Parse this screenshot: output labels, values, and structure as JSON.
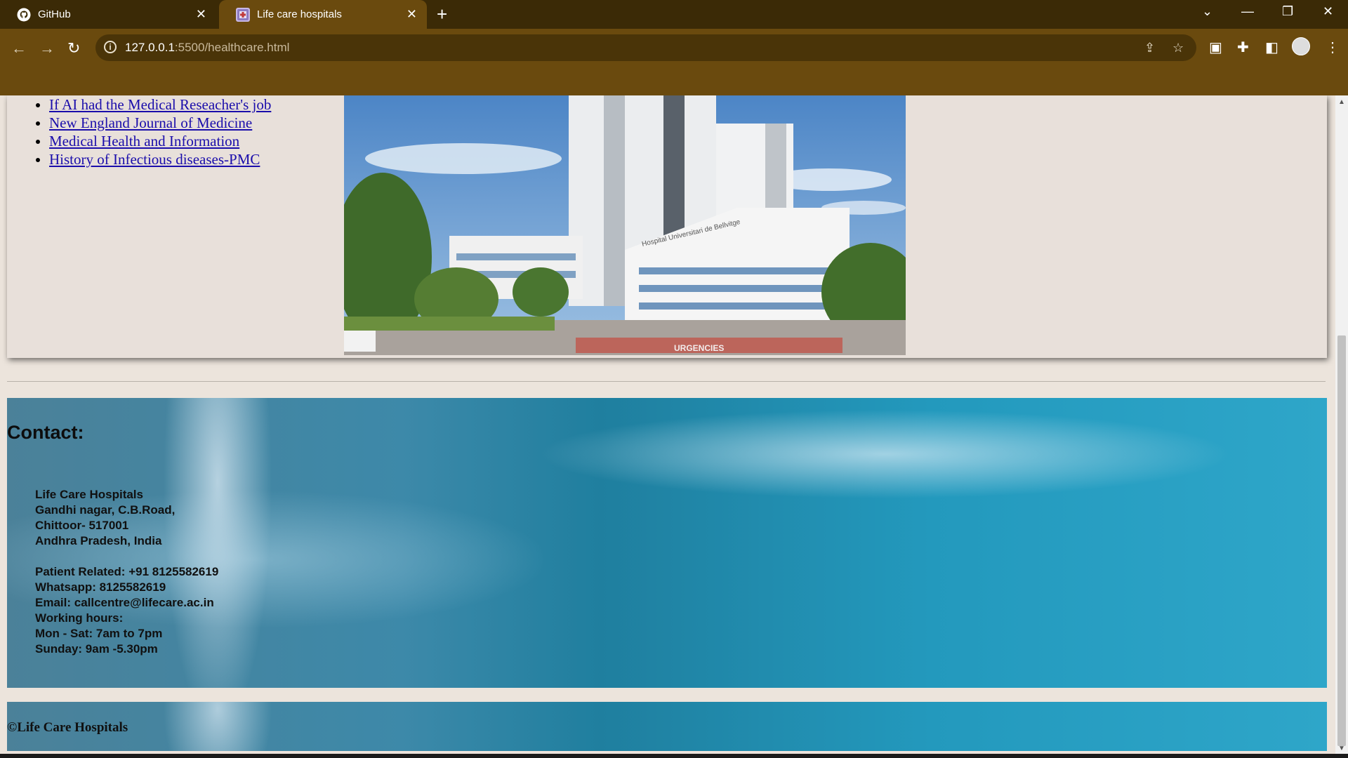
{
  "browser": {
    "tabs": [
      {
        "title": "GitHub",
        "icon": "github-icon"
      },
      {
        "title": "Life care hospitals",
        "icon": "page-favicon-icon"
      }
    ],
    "url_host": "127.0.0.1",
    "url_path": ":5500/healthcare.html"
  },
  "page": {
    "links": [
      "If AI had the Medical Reseacher's job",
      "New England Journal of Medicine",
      "Medical Health and Information",
      "History of Infectious diseases-PMC"
    ],
    "hospital_image": {
      "sign_text": "Hospital Universitari de Bellvitge",
      "ground_text": "URGENCIES"
    },
    "contact": {
      "heading": "Contact:",
      "lines": [
        "Life Care Hospitals",
        "Gandhi nagar, C.B.Road,",
        "Chittoor- 517001",
        "Andhra Pradesh, India",
        "",
        "Patient Related: +91 8125582619",
        "Whatsapp: 8125582619",
        "Email: callcentre@lifecare.ac.in",
        "Working hours:",
        "Mon - Sat: 7am to 7pm",
        "Sunday: 9am -5.30pm"
      ]
    },
    "footer": "©Life Care Hospitals"
  }
}
